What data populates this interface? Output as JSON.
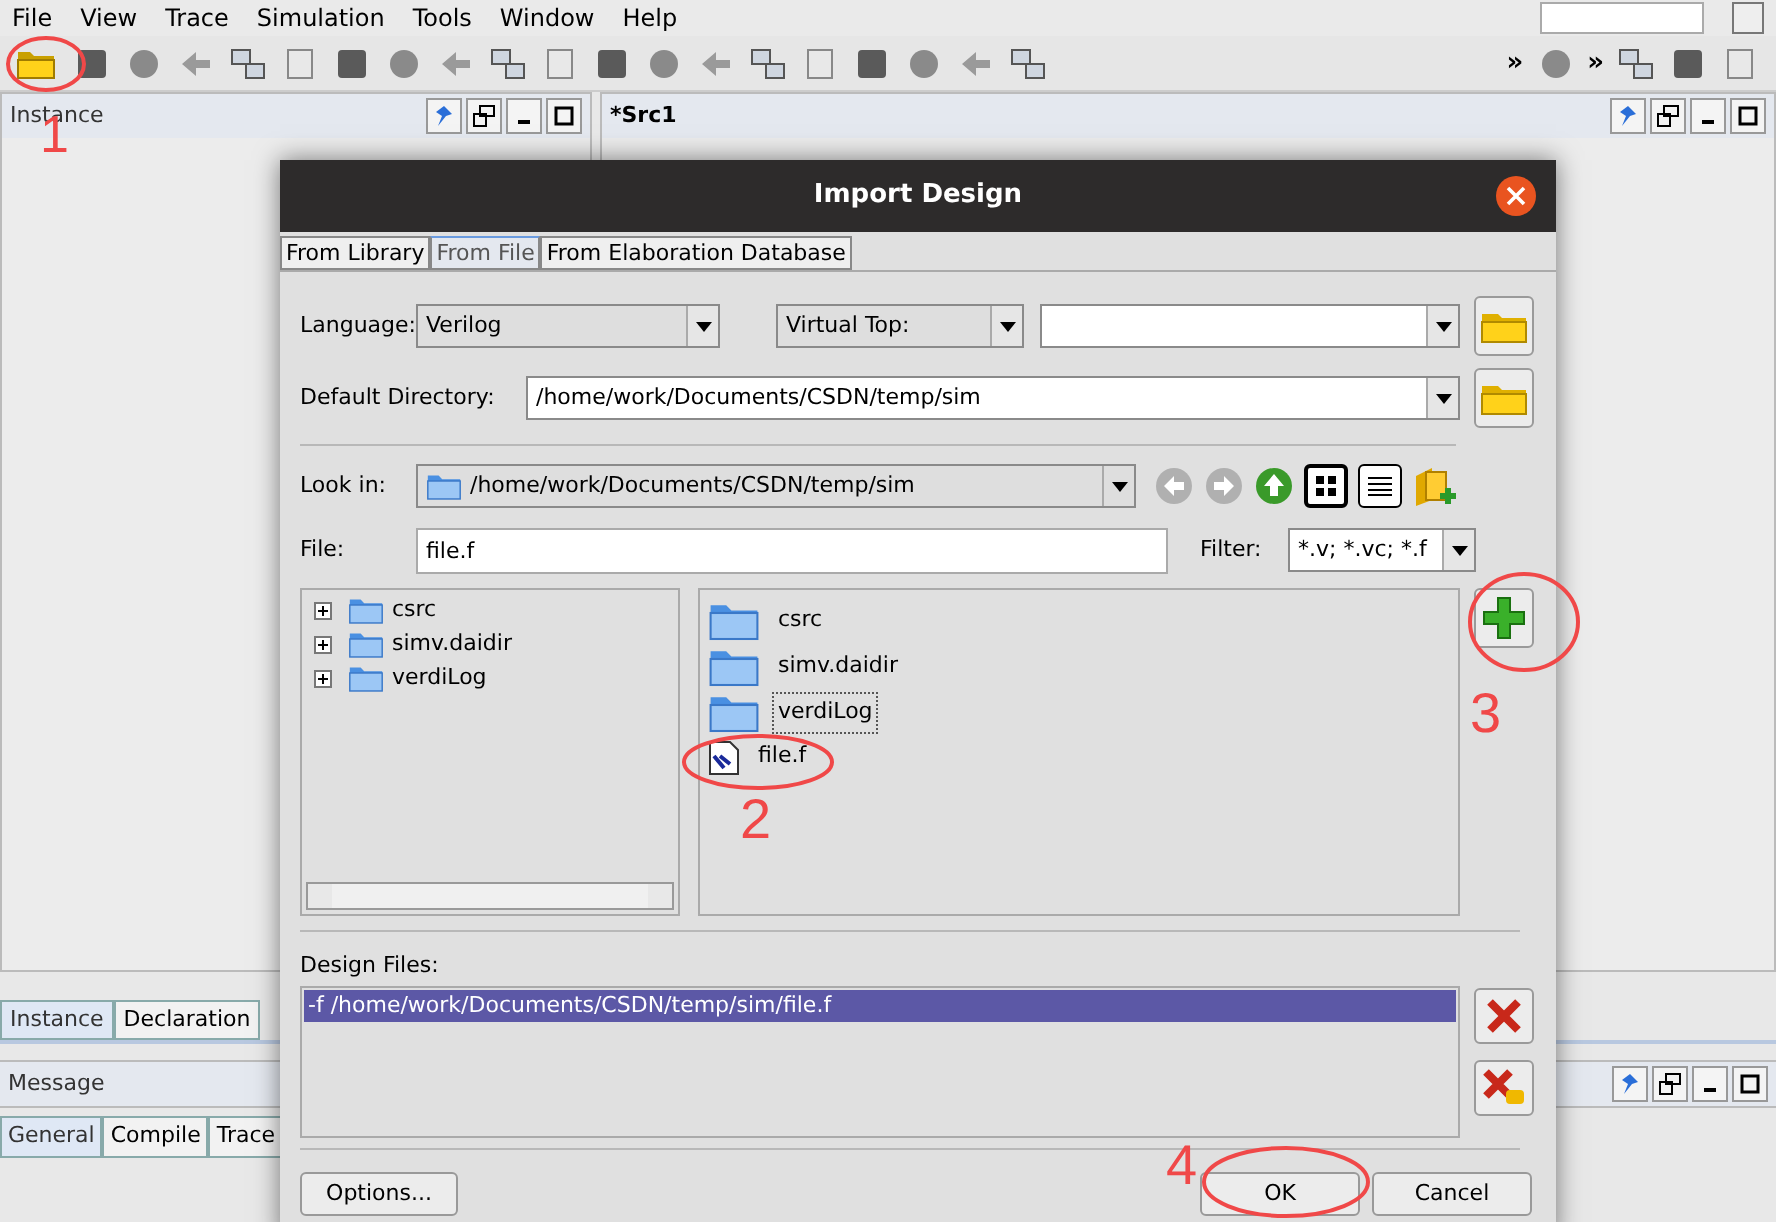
{
  "menu": [
    {
      "label": "File"
    },
    {
      "label": "View"
    },
    {
      "label": "Trace"
    },
    {
      "label": "Simulation"
    },
    {
      "label": "Tools"
    },
    {
      "label": "Window"
    },
    {
      "label": "Help"
    }
  ],
  "toolbar": {
    "overflow": [
      "»",
      "»"
    ]
  },
  "left_panel": {
    "title": "Instance",
    "tabs": [
      {
        "label": "Instance",
        "selected": true
      },
      {
        "label": "Declaration",
        "selected": false
      }
    ]
  },
  "right_panel": {
    "title": "*Src1"
  },
  "message_panel": {
    "title": "Message",
    "tabs": [
      {
        "label": "General",
        "selected": true
      },
      {
        "label": "Compile",
        "selected": false
      },
      {
        "label": "Trace",
        "selected": false
      }
    ]
  },
  "dialog": {
    "title": "Import Design",
    "tabs": [
      {
        "label": "From Library",
        "selected": false
      },
      {
        "label": "From File",
        "selected": true
      },
      {
        "label": "From Elaboration Database",
        "selected": false
      }
    ],
    "language": {
      "label": "Language:",
      "value": "Verilog"
    },
    "virtual_top": {
      "value": "Virtual Top:"
    },
    "default_directory": {
      "label": "Default Directory:",
      "value": "/home/work/Documents/CSDN/temp/sim"
    },
    "look_in": {
      "label": "Look in:",
      "value": "/home/work/Documents/CSDN/temp/sim"
    },
    "file": {
      "label": "File:",
      "value": "file.f"
    },
    "filter": {
      "label": "Filter:",
      "value": "*.v; *.vc; *.f"
    },
    "tree": [
      {
        "name": "csrc",
        "expanded": false
      },
      {
        "name": "simv.daidir",
        "expanded": false
      },
      {
        "name": "verdiLog",
        "expanded": false
      }
    ],
    "files": [
      {
        "name": "csrc",
        "kind": "folder",
        "focused": false
      },
      {
        "name": "simv.daidir",
        "kind": "folder",
        "focused": false
      },
      {
        "name": "verdiLog",
        "kind": "folder",
        "focused": true
      },
      {
        "name": "file.f",
        "kind": "file",
        "focused": false
      }
    ],
    "design_files": {
      "label": "Design Files:",
      "rows": [
        {
          "text": "-f /home/work/Documents/CSDN/temp/sim/file.f",
          "selected": true
        }
      ]
    },
    "buttons": [
      {
        "label": "Options..."
      },
      {
        "label": "OK"
      },
      {
        "label": "Cancel"
      }
    ]
  },
  "annotations": [
    {
      "label": "1"
    },
    {
      "label": "2"
    },
    {
      "label": "3"
    },
    {
      "label": "4"
    }
  ]
}
